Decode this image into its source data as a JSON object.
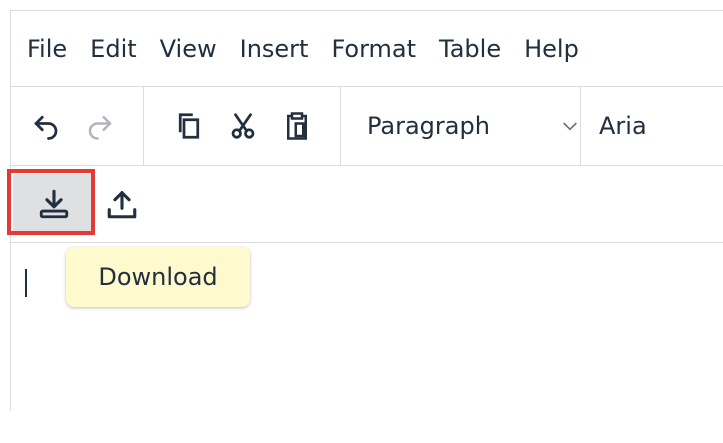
{
  "menubar": {
    "items": [
      "File",
      "Edit",
      "View",
      "Insert",
      "Format",
      "Table",
      "Help"
    ]
  },
  "toolbar": {
    "buttons": [
      {
        "icon": "undo-icon",
        "disabled": false
      },
      {
        "icon": "redo-icon",
        "disabled": true
      },
      {
        "icon": "copy-icon",
        "disabled": false
      },
      {
        "icon": "cut-icon",
        "disabled": false
      },
      {
        "icon": "paste-icon",
        "disabled": false
      }
    ],
    "block_format": "Paragraph",
    "font_family": "Aria"
  },
  "toolbar2": {
    "buttons": [
      {
        "icon": "download-icon",
        "active": true
      },
      {
        "icon": "upload-icon",
        "active": false
      }
    ]
  },
  "tooltip": {
    "text": "Download"
  },
  "colors": {
    "highlight": "#e53935",
    "tooltip_bg": "#fffacd",
    "active_button_bg": "#dee0e2",
    "text": "#222f3e"
  }
}
